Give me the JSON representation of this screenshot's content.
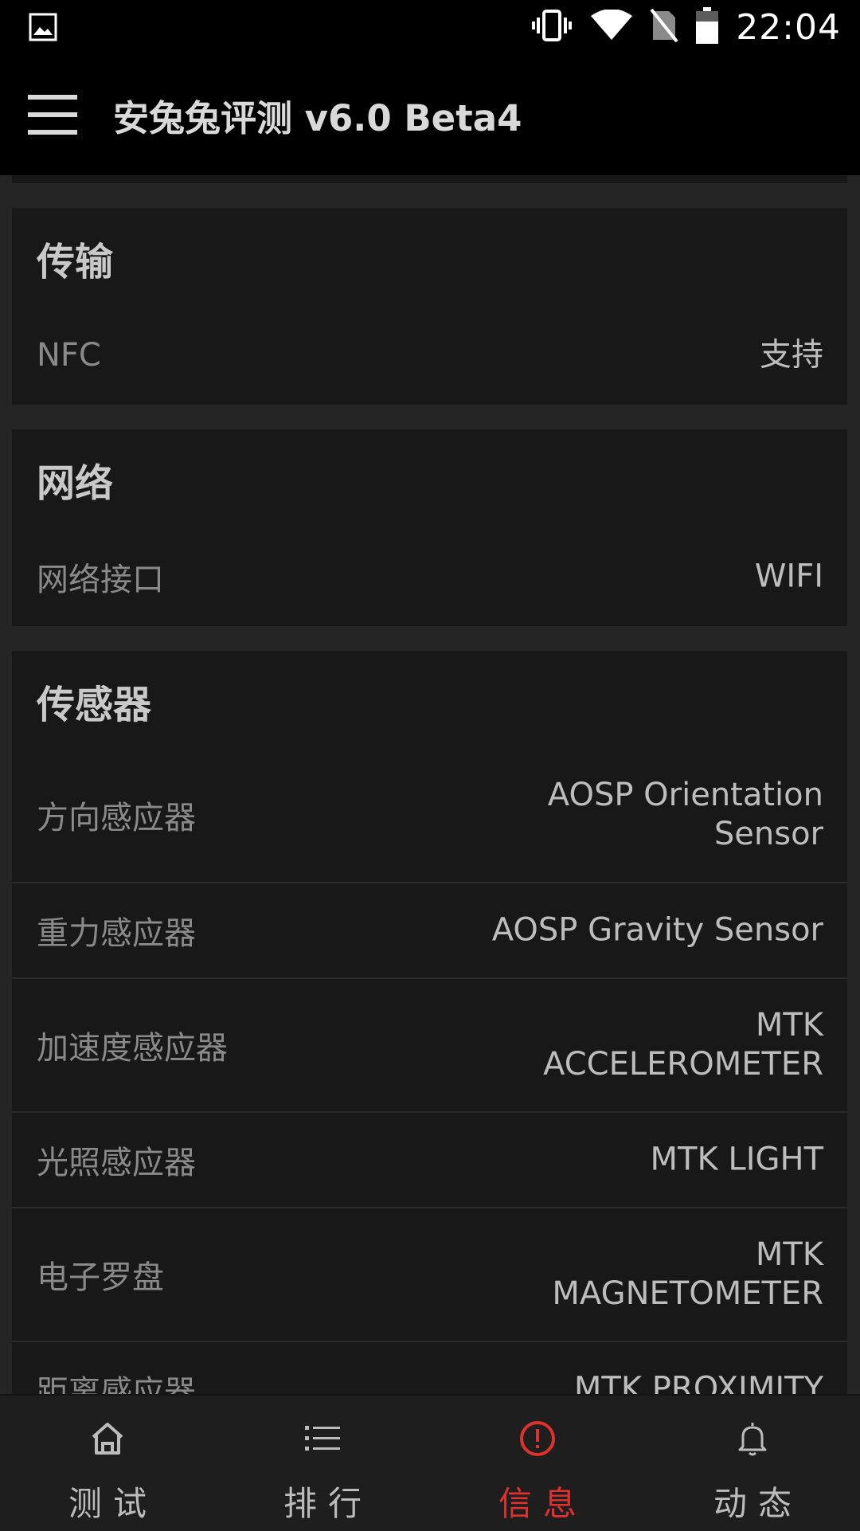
{
  "status_bar": {
    "time": "22:04",
    "icons": [
      "image-icon",
      "vibrate-icon",
      "wifi-icon",
      "no-sim-icon",
      "battery-icon"
    ]
  },
  "app_bar": {
    "title": "安兔兔评测 v6.0 Beta4",
    "menu_icon": "hamburger-menu-icon"
  },
  "sections": {
    "transfer": {
      "title": "传输",
      "rows": [
        {
          "key": "NFC",
          "value": "支持"
        }
      ]
    },
    "network": {
      "title": "网络",
      "rows": [
        {
          "key": "网络接口",
          "value": "WIFI"
        }
      ]
    },
    "sensors": {
      "title": "传感器",
      "rows": [
        {
          "key": "方向感应器",
          "value": "AOSP Orientation Sensor"
        },
        {
          "key": "重力感应器",
          "value": "AOSP Gravity Sensor"
        },
        {
          "key": "加速度感应器",
          "value": "MTK ACCELEROMETER"
        },
        {
          "key": "光照感应器",
          "value": "MTK LIGHT"
        },
        {
          "key": "电子罗盘",
          "value": "MTK MAGNETOMETER"
        },
        {
          "key": "距离感应器",
          "value": "MTK PROXIMITY"
        }
      ]
    }
  },
  "bottom_nav": {
    "tabs": [
      {
        "label": "测试",
        "icon": "home-icon",
        "active": false
      },
      {
        "label": "排行",
        "icon": "list-icon",
        "active": false
      },
      {
        "label": "信息",
        "icon": "info-alert-icon",
        "active": true
      },
      {
        "label": "动态",
        "icon": "bell-icon",
        "active": false
      }
    ]
  },
  "colors": {
    "accent": "#e0312f",
    "background": "#252525",
    "card": "#181818",
    "bar": "#000000"
  }
}
